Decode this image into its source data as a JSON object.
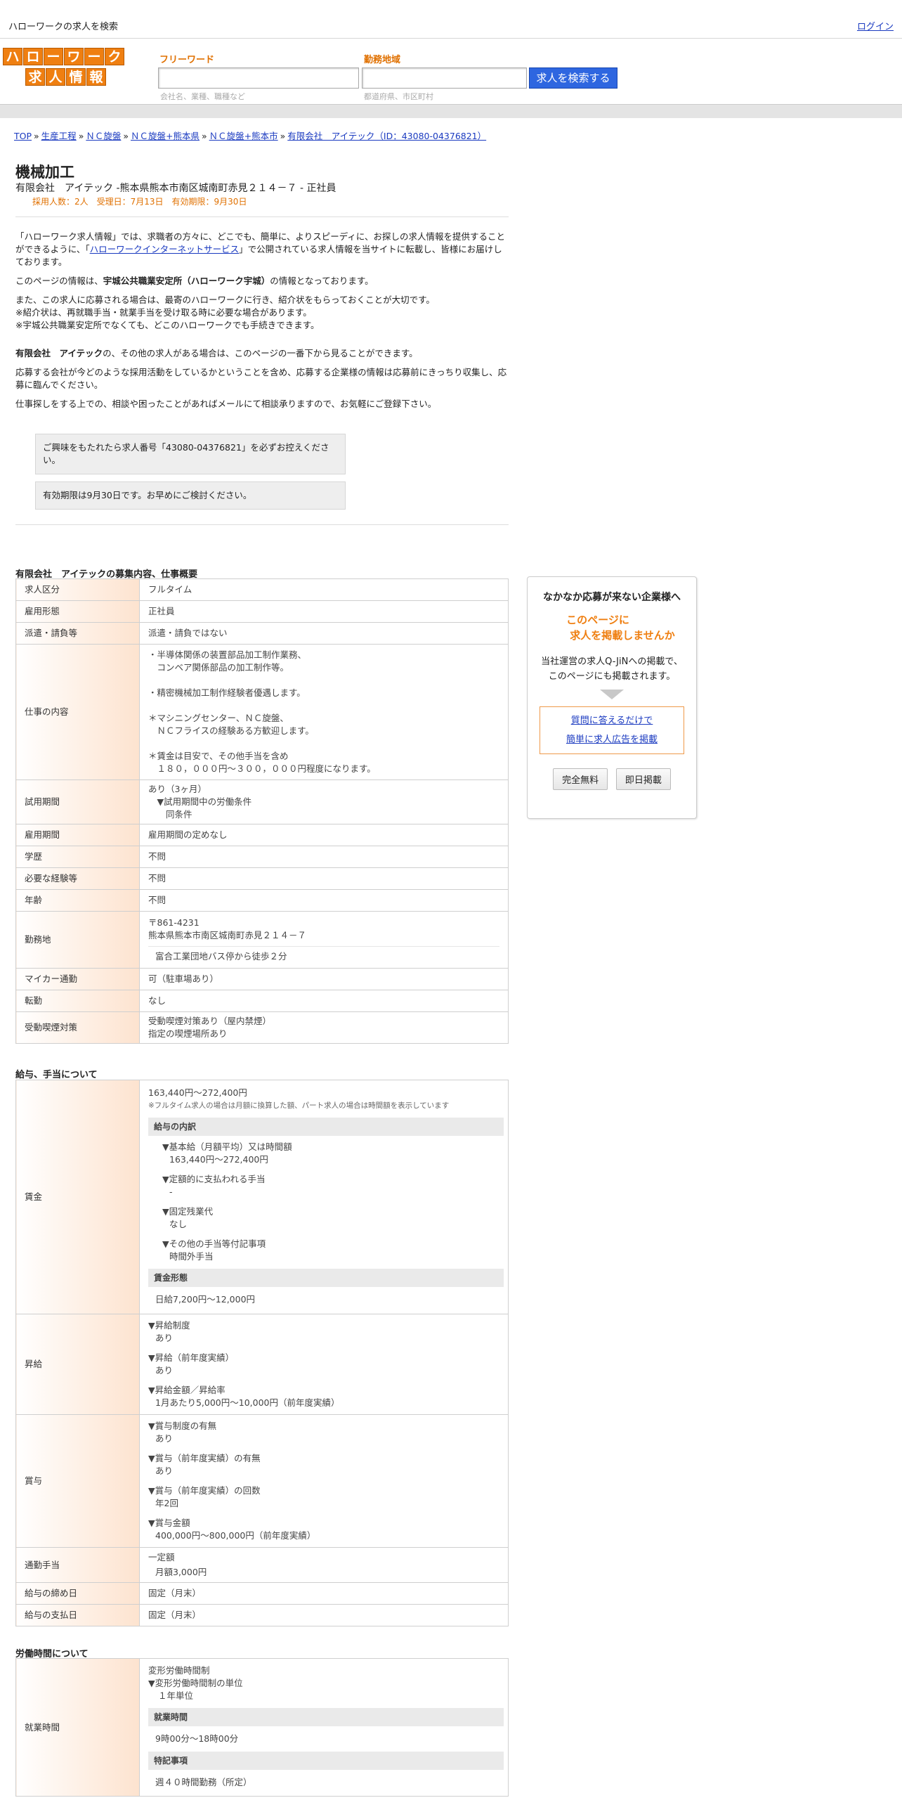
{
  "topbar": {
    "site_title": "ハローワークの求人を検索",
    "login_label": "ログイン"
  },
  "logo": {
    "row1": [
      "ハ",
      "ロ",
      "ー",
      "ワ",
      "ー",
      "ク"
    ],
    "row2": [
      "求",
      "人",
      "情",
      "報"
    ]
  },
  "search": {
    "freeword_label": "フリーワード",
    "freeword_hint": "会社名、業種、職種など",
    "area_label": "勤務地域",
    "area_hint": "都道府県、市区町村",
    "button_label": "求人を検索する"
  },
  "breadcrumb": [
    "TOP",
    "生産工程",
    "ＮＣ旋盤",
    "ＮＣ旋盤+熊本県",
    "ＮＣ旋盤+熊本市",
    "有限会社　アイテック（ID：43080-04376821）"
  ],
  "breadcrumb_sep": "»",
  "job": {
    "title": "機械加工",
    "company_line": "有限会社　アイテック -熊本県熊本市南区城南町赤見２１４－７ - 正社員",
    "meta": "採用人数：2人　受理日：7月13日　有効期限：9月30日"
  },
  "intro": {
    "p1_a": "「ハローワーク求人情報」では、求職者の方々に、どこでも、簡単に、よりスピーディに、お探しの求人情報を提供することができるように、「",
    "p1_link": "ハローワークインターネットサービス",
    "p1_b": "」で公開されている求人情報を当サイトに転載し、皆様にお届けしております。",
    "p2_a": "このページの情報は、",
    "p2_bold": "宇城公共職業安定所（ハローワーク宇城）",
    "p2_b": "の情報となっております。",
    "p3_l1": "また、この求人に応募される場合は、最寄のハローワークに行き、紹介状をもらっておくことが大切です。",
    "p3_l2": "※紹介状は、再就職手当・就業手当を受け取る時に必要な場合があります。",
    "p3_l3": "※宇城公共職業安定所でなくても、どこのハローワークでも手続きできます。",
    "p4_bold": "有限会社　アイテック",
    "p4_b": "の、その他の求人がある場合は、このページの一番下から見ることができます。",
    "p5": "応募する会社が今どのような採用活動をしているかということを含め、応募する企業様の情報は応募前にきっちり収集し、応募に臨んでください。",
    "p6": "仕事探しをする上での、相談や困ったことがあればメールにて相談承りますので、お気軽にご登録下さい。"
  },
  "notices": [
    "ご興味をもたれたら求人番号「43080-04376821」を必ずお控えください。",
    "有効期限は9月30日です。お早めにご検討ください。"
  ],
  "section1": {
    "title": "有限会社　アイテックの募集内容、仕事概要",
    "rows": [
      {
        "label": "求人区分",
        "value": "フルタイム"
      },
      {
        "label": "雇用形態",
        "value": "正社員"
      },
      {
        "label": "派遣・請負等",
        "value": "派遣・請負ではない"
      },
      {
        "label": "仕事の内容",
        "lines": [
          "・半導体関係の装置部品加工制作業務、",
          "　コンベア関係部品の加工制作等。",
          "",
          "・精密機械加工制作経験者優遇します。",
          "",
          "＊マシニングセンター、ＮＣ旋盤、",
          "　ＮＣフライスの経験ある方歓迎します。",
          "",
          "＊賃金は目安で、その他手当を含め",
          "　１８０，０００円～３００，０００円程度になります。"
        ]
      },
      {
        "label": "試用期間",
        "lines": [
          "あり（3ヶ月）",
          "　▼試用期間中の労働条件",
          "　　同条件"
        ]
      },
      {
        "label": "雇用期間",
        "value": "雇用期間の定めなし"
      },
      {
        "label": "学歴",
        "value": "不問"
      },
      {
        "label": "必要な経験等",
        "value": "不問"
      },
      {
        "label": "年齢",
        "value": "不問"
      },
      {
        "label": "勤務地",
        "lines": [
          "〒861-4231",
          "熊本県熊本市南区城南町赤見２１４－７"
        ],
        "extra": "富合工業団地バス停から徒歩２分"
      },
      {
        "label": "マイカー通勤",
        "value": "可（駐車場あり）"
      },
      {
        "label": "転勤",
        "value": "なし"
      },
      {
        "label": "受動喫煙対策",
        "lines": [
          "受動喫煙対策あり（屋内禁煙）",
          "指定の喫煙場所あり"
        ]
      }
    ]
  },
  "section2": {
    "title": "給与、手当について",
    "wage": {
      "label": "賃金",
      "amount": "163,440円〜272,400円",
      "note": "※フルタイム求人の場合は月額に換算した額、パート求人の場合は時間額を表示しています",
      "breakdown_header": "給与の内訳",
      "items": [
        {
          "head": "▼基本給（月額平均）又は時間額",
          "val": "163,440円〜272,400円"
        },
        {
          "head": "▼定額的に支払われる手当",
          "val": "-"
        },
        {
          "head": "▼固定残業代",
          "val": "なし"
        },
        {
          "head": "▼その他の手当等付記事項",
          "val": "時間外手当"
        }
      ],
      "form_header": "賃金形態",
      "form_value": "日給7,200円〜12,000円"
    },
    "raise": {
      "label": "昇給",
      "items": [
        {
          "head": "▼昇給制度",
          "val": "あり"
        },
        {
          "head": "▼昇給（前年度実績）",
          "val": "あり"
        },
        {
          "head": "▼昇給金額／昇給率",
          "val": "1月あたり5,000円〜10,000円（前年度実績）"
        }
      ]
    },
    "bonus": {
      "label": "賞与",
      "items": [
        {
          "head": "▼賞与制度の有無",
          "val": "あり"
        },
        {
          "head": "▼賞与（前年度実績）の有無",
          "val": "あり"
        },
        {
          "head": "▼賞与（前年度実績）の回数",
          "val": "年2回"
        },
        {
          "head": "▼賞与金額",
          "val": "400,000円〜800,000円（前年度実績）"
        }
      ]
    },
    "commute": {
      "label": "通勤手当",
      "l1": "一定額",
      "l2": "月額3,000円"
    },
    "cutoff": {
      "label": "給与の締め日",
      "value": "固定（月末）"
    },
    "payday": {
      "label": "給与の支払日",
      "value": "固定（月末）"
    }
  },
  "section3": {
    "title": "労働時間について",
    "hours": {
      "label": "就業時間",
      "l1": "変形労働時間制",
      "l2": "▼変形労働時間制の単位",
      "l3": "１年単位",
      "hdr1": "就業時間",
      "time": "9時00分〜18時00分",
      "hdr2": "特記事項",
      "note": "週４０時間勤務（所定）"
    }
  },
  "sidebar": {
    "title": "なかなか応募が来ない企業様へ",
    "catch_l1": "このページに",
    "catch_l2": "求人を掲載しませんか",
    "desc_l1": "当社運営の求人Q-JiNへの掲載で、",
    "desc_l2": "このページにも掲載されます。",
    "link1": "質問に答えるだけで",
    "link2": "簡単に求人広告を掲載",
    "btn1": "完全無料",
    "btn2": "即日掲載"
  },
  "colors": {
    "accent_orange": "#ef7f11",
    "search_blue": "#2e66e0",
    "label_bg": "#fde3cf"
  }
}
